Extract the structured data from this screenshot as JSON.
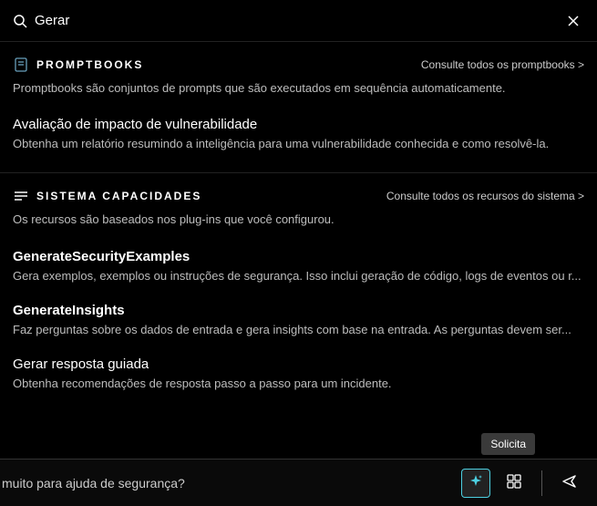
{
  "search": {
    "value": "Gerar"
  },
  "sections": {
    "promptbooks": {
      "title": "PROMPTBOOKS",
      "see_all": "Consulte todos os promptbooks &gt;",
      "desc": "Promptbooks são conjuntos de prompts que são executados em sequência automaticamente.",
      "items": [
        {
          "title": "Avaliação de impacto de vulnerabilidade",
          "desc": "Obtenha um relatório resumindo a inteligência para uma vulnerabilidade conhecida e como resolvê-la."
        }
      ]
    },
    "system": {
      "title": "SISTEMA  CAPACIDADES",
      "see_all": "Consulte todos os recursos do sistema &gt;",
      "desc": "Os recursos são baseados nos plug-ins que você configurou.",
      "items": [
        {
          "title": "GenerateSecurityExamples",
          "desc": "Gera exemplos, exemplos ou instruções de segurança. Isso inclui geração de código, logs de eventos ou r..."
        },
        {
          "title": "GenerateInsights",
          "desc": "Faz perguntas sobre os dados de entrada e gera insights com base na entrada. As perguntas devem ser..."
        },
        {
          "title": "Gerar resposta guiada",
          "desc": "Obtenha recomendações de resposta passo a passo para um incidente."
        }
      ]
    }
  },
  "footer": {
    "text": "muito para ajuda de segurança?"
  },
  "tooltip": "Solicita"
}
